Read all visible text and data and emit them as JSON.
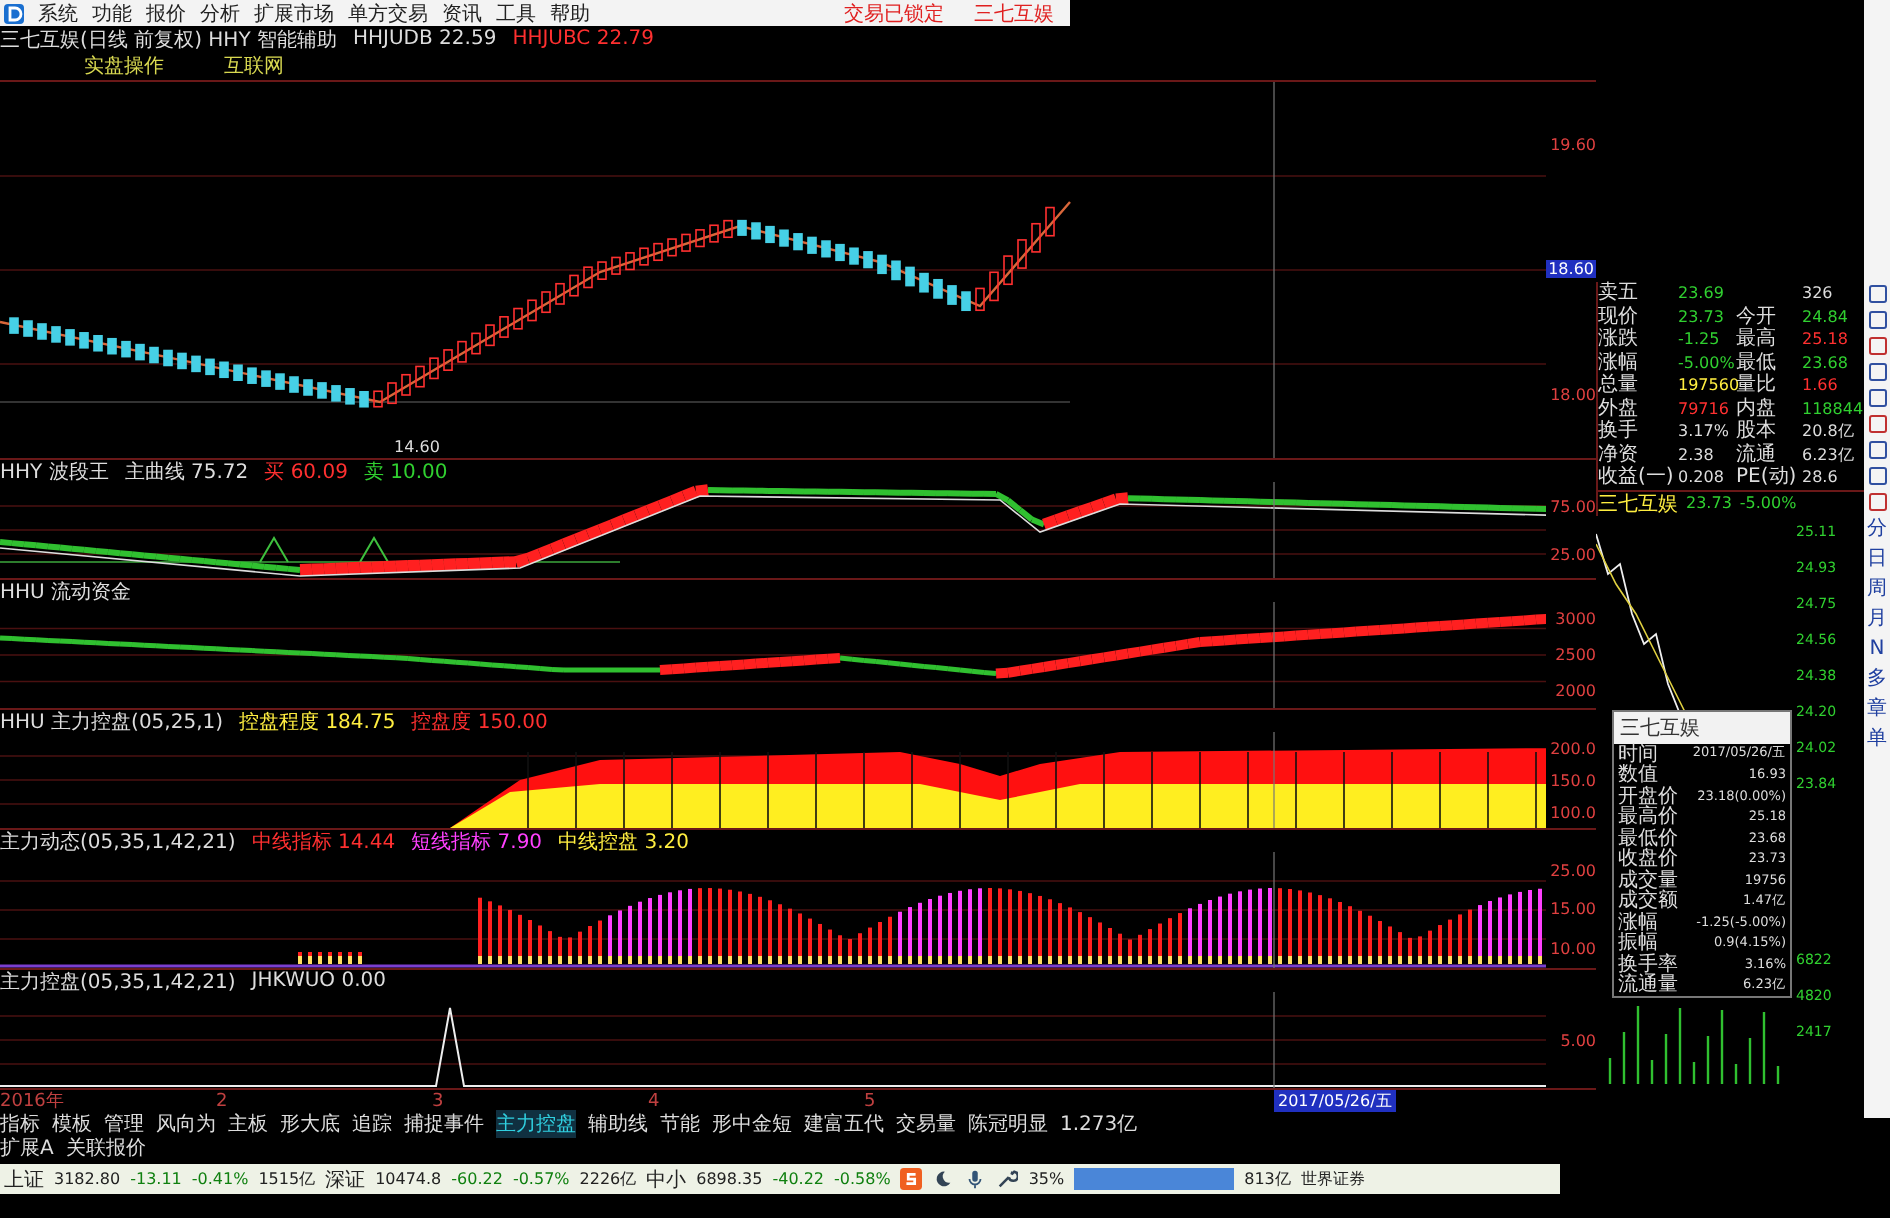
{
  "menu": {
    "items": [
      "系统",
      "功能",
      "报价",
      "分析",
      "扩展市场",
      "单方交易",
      "资讯",
      "工具",
      "帮助"
    ],
    "right": [
      "交易已锁定",
      "三七互娱"
    ]
  },
  "header": {
    "title": "三七互娱(日线 前复权) HHY 智能辅助",
    "readings": [
      {
        "text": "HHJUDB 22.59",
        "color": "#dddddd"
      },
      {
        "text": "HHJUBC 22.79",
        "color": "#ff3030"
      }
    ],
    "links": [
      "实盘操作",
      "互联网"
    ]
  },
  "panels": [
    {
      "kind": "candles",
      "axis": [
        {
          "text": "19.60",
          "cursor": false
        },
        {
          "text": "18.60",
          "cursor": true
        },
        {
          "text": "18.00",
          "cursor": false
        }
      ],
      "note": "14.60"
    },
    {
      "kind": "band",
      "title": "HHY 波段王",
      "readings": [
        {
          "text": "主曲线 75.72",
          "color": "#dddddd"
        },
        {
          "text": "买 60.09",
          "color": "#ff3030"
        },
        {
          "text": "卖 10.00",
          "color": "#30d030"
        }
      ],
      "axis": [
        {
          "text": "75.00",
          "cursor": false
        },
        {
          "text": "25.00",
          "cursor": false
        }
      ]
    },
    {
      "kind": "flow",
      "title": "HHU 流动资金",
      "axis": [
        {
          "text": "3000",
          "cursor": false
        },
        {
          "text": "2500",
          "cursor": false
        },
        {
          "text": "2000",
          "cursor": false
        }
      ]
    },
    {
      "kind": "stacked",
      "title": "HHU 主力控盘(05,25,1)",
      "readings": [
        {
          "text": "控盘程度 184.75",
          "color": "#ffee40"
        },
        {
          "text": "控盘度 150.00",
          "color": "#ff3030"
        }
      ],
      "axis": [
        {
          "text": "200.0",
          "cursor": false
        },
        {
          "text": "150.0",
          "cursor": false
        },
        {
          "text": "100.0",
          "cursor": false
        }
      ]
    },
    {
      "kind": "histogram",
      "title": "主力动态(05,35,1,42,21)",
      "readings": [
        {
          "text": "中线指标 14.44",
          "color": "#ff3030"
        },
        {
          "text": "短线指标 7.90",
          "color": "#ff40ff"
        },
        {
          "text": "中线控盘 3.20",
          "color": "#ffee40"
        }
      ],
      "axis": [
        {
          "text": "25.00",
          "cursor": false
        },
        {
          "text": "15.00",
          "cursor": false
        },
        {
          "text": "10.00",
          "cursor": false
        }
      ]
    },
    {
      "kind": "spike",
      "title": "主力控盘(05,35,1,42,21)",
      "readings": [
        {
          "text": "JHKWUO 0.00",
          "color": "#dddddd"
        }
      ],
      "axis": [
        {
          "text": "5.00",
          "cursor": false
        }
      ]
    }
  ],
  "dates": [
    "2016年",
    "2",
    "3",
    "4",
    "5"
  ],
  "cursor_date": "2017/05/26/五",
  "tabs": [
    {
      "label": "指标",
      "selected": false
    },
    {
      "label": "模板",
      "selected": false
    },
    {
      "label": "管理",
      "selected": false
    },
    {
      "label": "风向为",
      "selected": false
    },
    {
      "label": "主板",
      "selected": false
    },
    {
      "label": "形大底",
      "selected": false
    },
    {
      "label": "追踪",
      "selected": false
    },
    {
      "label": "捕捉事件",
      "selected": false
    },
    {
      "label": "主力控盘",
      "selected": true
    },
    {
      "label": "辅助线",
      "selected": false
    },
    {
      "label": "节能",
      "selected": false
    },
    {
      "label": "形中金短",
      "selected": false
    },
    {
      "label": "建富五代",
      "selected": false
    },
    {
      "label": "交易量",
      "selected": false
    },
    {
      "label": "陈冠明显",
      "selected": false
    },
    {
      "label": "1.273亿",
      "selected": false
    }
  ],
  "sub_tabs": [
    "扩展A",
    "关联报价"
  ],
  "status_bar": {
    "indices": [
      {
        "name": "上证",
        "value": "3182.80",
        "change": "-13.11",
        "pct": "-0.41%",
        "amount": "1515亿"
      },
      {
        "name": "深证",
        "value": "10474.8",
        "change": "-60.22",
        "pct": "-0.57%",
        "amount": "2226亿"
      },
      {
        "name": "中小",
        "value": "6898.35",
        "change": "-40.22",
        "pct": "-0.58%"
      }
    ],
    "percent": "35%",
    "amount": "813亿",
    "broker": "世界证券"
  },
  "quote": {
    "rows": [
      [
        {
          "label": "卖五",
          "value": "23.69",
          "color": "#30d030"
        },
        {
          "value": "326",
          "color": "#dddddd"
        }
      ],
      [
        {
          "label": "现价",
          "value": "23.73",
          "color": "#30d030"
        },
        {
          "label": "今开",
          "value": "24.84",
          "color": "#30d030"
        }
      ],
      [
        {
          "label": "涨跌",
          "value": "-1.25",
          "color": "#30d030"
        },
        {
          "label": "最高",
          "value": "25.18",
          "color": "#ff3030"
        }
      ],
      [
        {
          "label": "涨幅",
          "value": "-5.00%",
          "color": "#30d030"
        },
        {
          "label": "最低",
          "value": "23.68",
          "color": "#30d030"
        }
      ],
      [
        {
          "label": "总量",
          "value": "197560",
          "color": "#ffee40"
        },
        {
          "label": "量比",
          "value": "1.66",
          "color": "#ff3030"
        }
      ],
      [
        {
          "label": "外盘",
          "value": "79716",
          "color": "#ff3030"
        },
        {
          "label": "内盘",
          "value": "118844",
          "color": "#30d030"
        }
      ],
      [
        {
          "label": "换手",
          "value": "3.17%",
          "color": "#dddddd"
        },
        {
          "label": "股本",
          "value": "20.8亿",
          "color": "#dddddd"
        }
      ],
      [
        {
          "label": "净资",
          "value": "2.38",
          "color": "#dddddd"
        },
        {
          "label": "流通",
          "value": "6.23亿",
          "color": "#dddddd"
        }
      ],
      [
        {
          "label": "收益(一)",
          "value": "0.208",
          "color": "#dddddd"
        },
        {
          "label": "PE(动)",
          "value": "28.6",
          "color": "#dddddd"
        }
      ]
    ],
    "ticker": {
      "name": "三七互娱",
      "price": "23.73",
      "pct": "-5.00%"
    }
  },
  "minute": {
    "prices": [
      "25.11",
      "24.93",
      "24.75",
      "24.56",
      "24.38",
      "24.20",
      "24.02",
      "23.84"
    ],
    "volumes": [
      "6822",
      "4820",
      "2417"
    ]
  },
  "popup": {
    "title": "三七互娱",
    "rows": [
      {
        "label": "时间",
        "value": "2017/05/26/五"
      },
      {
        "label": "数值",
        "value": "16.93"
      },
      {
        "label": "开盘价",
        "value": "23.18(0.00%)"
      },
      {
        "label": "最高价",
        "value": "25.18"
      },
      {
        "label": "最低价",
        "value": "23.68"
      },
      {
        "label": "收盘价",
        "value": "23.73"
      },
      {
        "label": "成交量",
        "value": "19756"
      },
      {
        "label": "成交额",
        "value": "1.47亿"
      },
      {
        "label": "涨幅",
        "value": "-1.25(-5.00%)"
      },
      {
        "label": "振幅",
        "value": "0.9(4.15%)"
      },
      {
        "label": "换手率",
        "value": "3.16%"
      },
      {
        "label": "流通量",
        "value": "6.23亿"
      }
    ]
  },
  "side_tools": [
    "分",
    "日",
    "周",
    "月",
    "N",
    "多",
    "章",
    "单"
  ]
}
